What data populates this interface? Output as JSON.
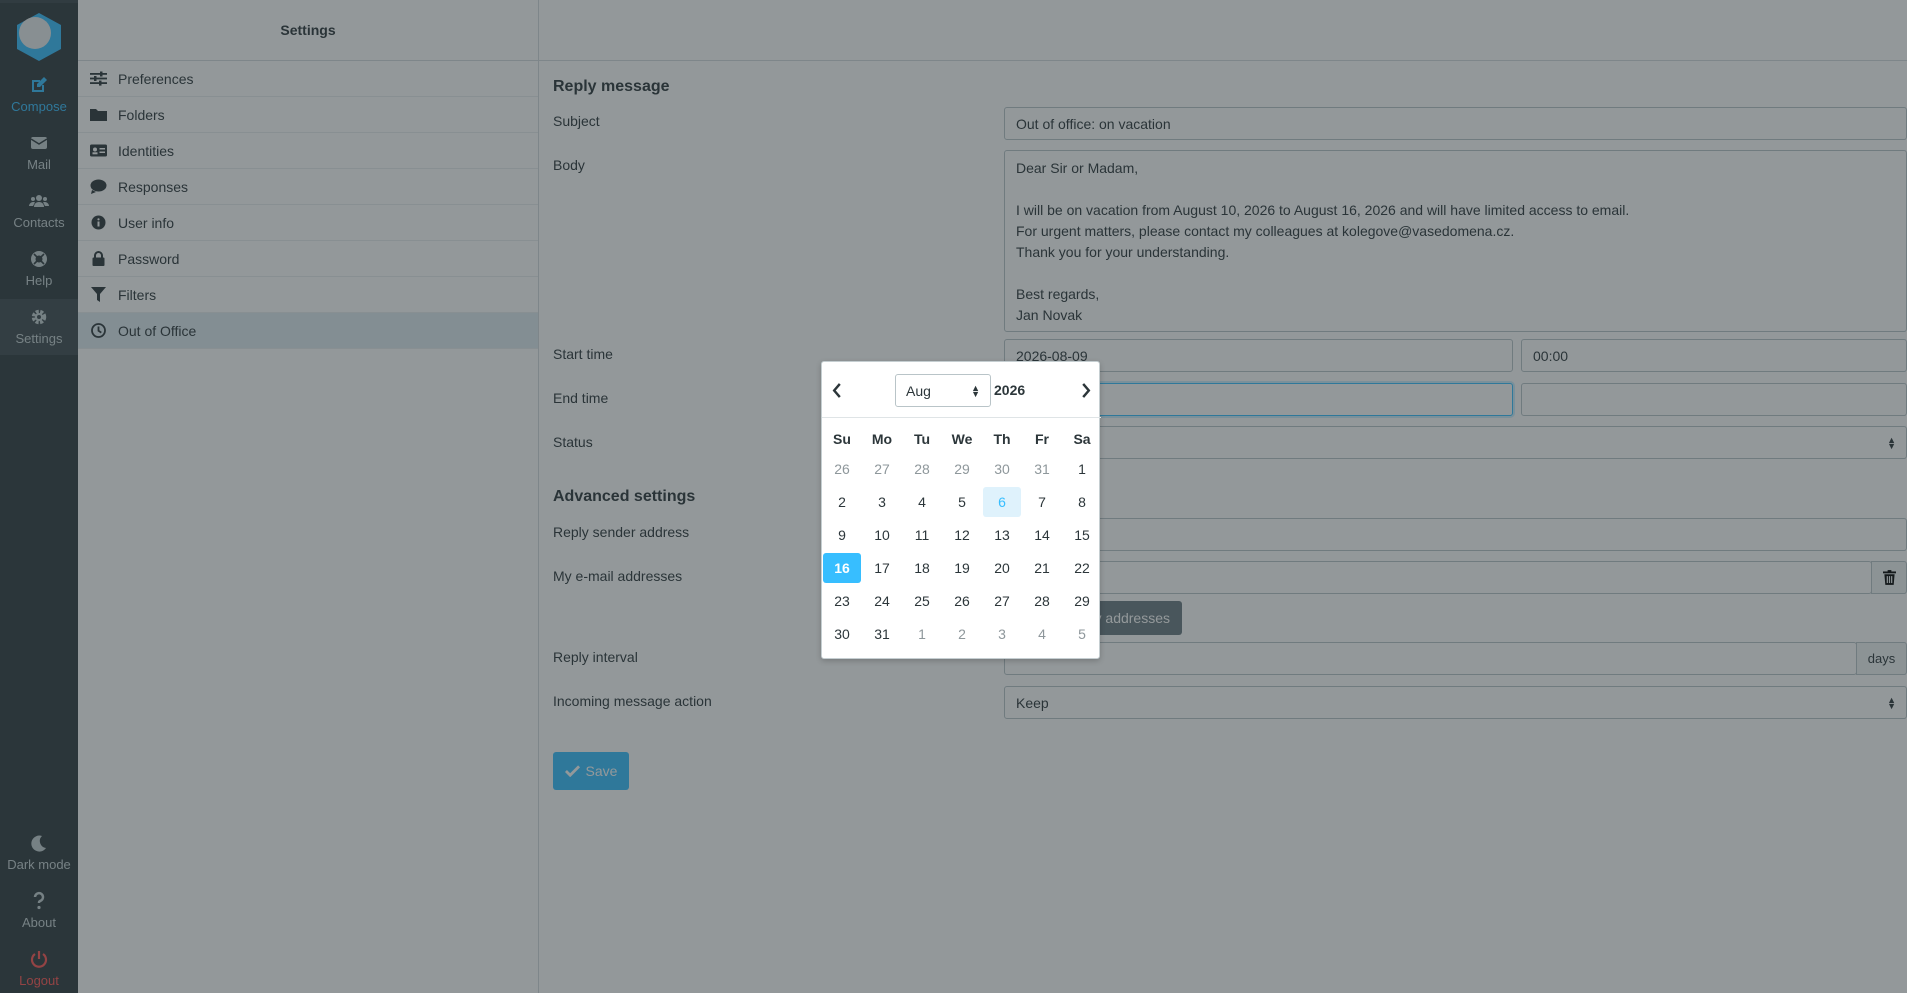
{
  "nav": {
    "items": [
      {
        "label": "Compose",
        "icon": "compose-icon"
      },
      {
        "label": "Mail",
        "icon": "mail-icon"
      },
      {
        "label": "Contacts",
        "icon": "contacts-icon"
      },
      {
        "label": "Help",
        "icon": "help-icon"
      },
      {
        "label": "Settings",
        "icon": "gear-icon"
      }
    ],
    "bottom": [
      {
        "label": "Dark mode",
        "icon": "moon-icon"
      },
      {
        "label": "About",
        "icon": "question-icon"
      },
      {
        "label": "Logout",
        "icon": "power-icon"
      }
    ]
  },
  "settings": {
    "title": "Settings",
    "items": [
      {
        "label": "Preferences",
        "icon": "sliders-icon"
      },
      {
        "label": "Folders",
        "icon": "folder-icon"
      },
      {
        "label": "Identities",
        "icon": "id-card-icon"
      },
      {
        "label": "Responses",
        "icon": "comment-icon"
      },
      {
        "label": "User info",
        "icon": "info-icon"
      },
      {
        "label": "Password",
        "icon": "lock-icon"
      },
      {
        "label": "Filters",
        "icon": "filter-icon"
      },
      {
        "label": "Out of Office",
        "icon": "clock-icon"
      }
    ]
  },
  "form": {
    "reply_title": "Reply message",
    "subject_label": "Subject",
    "subject_value": "Out of office: on vacation",
    "body_label": "Body",
    "body_value": "Dear Sir or Madam,\n\nI will be on vacation from August 10, 2026 to August 16, 2026 and will have limited access to email.\nFor urgent matters, please contact my colleagues at kolegove@vasedomena.cz.\nThank you for your understanding.\n\nBest regards,\nJan Novak",
    "start_label": "Start time",
    "start_date": "2026-08-09",
    "start_time": "00:00",
    "end_label": "End time",
    "end_date": "",
    "end_time": "",
    "status_label": "Status",
    "advanced_title": "Advanced settings",
    "reply_sender_label": "Reply sender address",
    "my_addresses_label": "My e-mail addresses",
    "my_addresses_button": "My e-mail addresses",
    "my_addresses_button_visible": "y addresses",
    "reply_interval_label": "Reply interval",
    "reply_interval_unit": "days",
    "incoming_action_label": "Incoming message action",
    "incoming_action_value": "Keep",
    "save_label": "Save"
  },
  "datepicker": {
    "month": "Aug",
    "year": "2026",
    "weekdays": [
      "Su",
      "Mo",
      "Tu",
      "We",
      "Th",
      "Fr",
      "Sa"
    ],
    "weeks": [
      [
        {
          "d": "26",
          "o": true
        },
        {
          "d": "27",
          "o": true
        },
        {
          "d": "28",
          "o": true
        },
        {
          "d": "29",
          "o": true
        },
        {
          "d": "30",
          "o": true
        },
        {
          "d": "31",
          "o": true
        },
        {
          "d": "1"
        }
      ],
      [
        {
          "d": "2"
        },
        {
          "d": "3"
        },
        {
          "d": "4"
        },
        {
          "d": "5"
        },
        {
          "d": "6",
          "today": true
        },
        {
          "d": "7"
        },
        {
          "d": "8"
        }
      ],
      [
        {
          "d": "9"
        },
        {
          "d": "10"
        },
        {
          "d": "11"
        },
        {
          "d": "12"
        },
        {
          "d": "13"
        },
        {
          "d": "14"
        },
        {
          "d": "15"
        }
      ],
      [
        {
          "d": "16",
          "sel": true
        },
        {
          "d": "17"
        },
        {
          "d": "18"
        },
        {
          "d": "19"
        },
        {
          "d": "20"
        },
        {
          "d": "21"
        },
        {
          "d": "22"
        }
      ],
      [
        {
          "d": "23"
        },
        {
          "d": "24"
        },
        {
          "d": "25"
        },
        {
          "d": "26"
        },
        {
          "d": "27"
        },
        {
          "d": "28"
        },
        {
          "d": "29"
        }
      ],
      [
        {
          "d": "30"
        },
        {
          "d": "31"
        },
        {
          "d": "1",
          "o": true
        },
        {
          "d": "2",
          "o": true
        },
        {
          "d": "3",
          "o": true
        },
        {
          "d": "4",
          "o": true
        },
        {
          "d": "5",
          "o": true
        }
      ]
    ]
  },
  "colors": {
    "accent": "#37beff",
    "rail_bg": "#2f3a3f",
    "logout": "#ff5552"
  }
}
